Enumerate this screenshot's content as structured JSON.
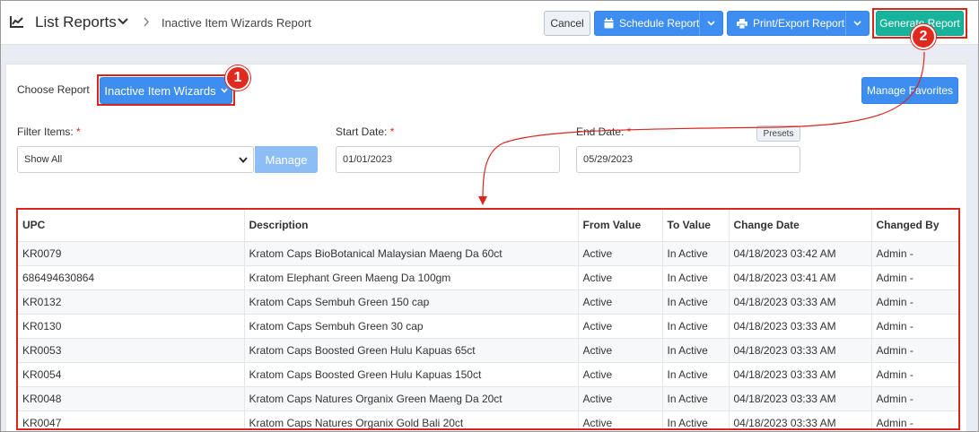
{
  "header": {
    "title": "List Reports",
    "breadcrumb": "Inactive Item Wizards Report",
    "cancel_label": "Cancel",
    "schedule_label": "Schedule Report",
    "print_label": "Print/Export Report",
    "generate_label": "Generate Report"
  },
  "report": {
    "choose_label": "Choose Report",
    "selected": "Inactive Item Wizards",
    "manage_favorites_label": "Manage Favorites"
  },
  "filters": {
    "filter_items_label": "Filter Items:",
    "filter_items_value": "Show All",
    "manage_label": "Manage",
    "start_label": "Start Date:",
    "start_value": "01/01/2023",
    "end_label": "End Date:",
    "end_value": "05/29/2023",
    "presets_label": "Presets",
    "required_mark": "*"
  },
  "callouts": {
    "one": "1",
    "two": "2"
  },
  "table": {
    "columns": [
      "UPC",
      "Description",
      "From Value",
      "To Value",
      "Change Date",
      "Changed By"
    ],
    "rows": [
      [
        "KR0079",
        "Kratom Caps BioBotanical Malaysian Maeng Da 60ct",
        "Active",
        "In Active",
        "04/18/2023 03:42 AM",
        "Admin -"
      ],
      [
        "686494630864",
        "Kratom Elephant Green Maeng Da 100gm",
        "Active",
        "In Active",
        "04/18/2023 03:41 AM",
        "Admin -"
      ],
      [
        "KR0132",
        "Kratom Caps Sembuh Green 150 cap",
        "Active",
        "In Active",
        "04/18/2023 03:33 AM",
        "Admin -"
      ],
      [
        "KR0130",
        "Kratom Caps Sembuh Green 30 cap",
        "Active",
        "In Active",
        "04/18/2023 03:33 AM",
        "Admin -"
      ],
      [
        "KR0053",
        "Kratom Caps Boosted Green Hulu Kapuas 65ct",
        "Active",
        "In Active",
        "04/18/2023 03:33 AM",
        "Admin -"
      ],
      [
        "KR0054",
        "Kratom Caps Boosted Green Hulu Kapuas 150ct",
        "Active",
        "In Active",
        "04/18/2023 03:33 AM",
        "Admin -"
      ],
      [
        "KR0048",
        "Kratom Caps Natures Organix Green Maeng Da 20ct",
        "Active",
        "In Active",
        "04/18/2023 03:33 AM",
        "Admin -"
      ],
      [
        "KR0047",
        "Kratom Caps Natures Organix Gold Bali 20ct",
        "Active",
        "In Active",
        "04/18/2023 03:33 AM",
        "Admin -"
      ]
    ]
  },
  "colors": {
    "primary_blue": "#3d8ef0",
    "generate_teal": "#17b39b",
    "highlight_red": "#d9261c"
  }
}
